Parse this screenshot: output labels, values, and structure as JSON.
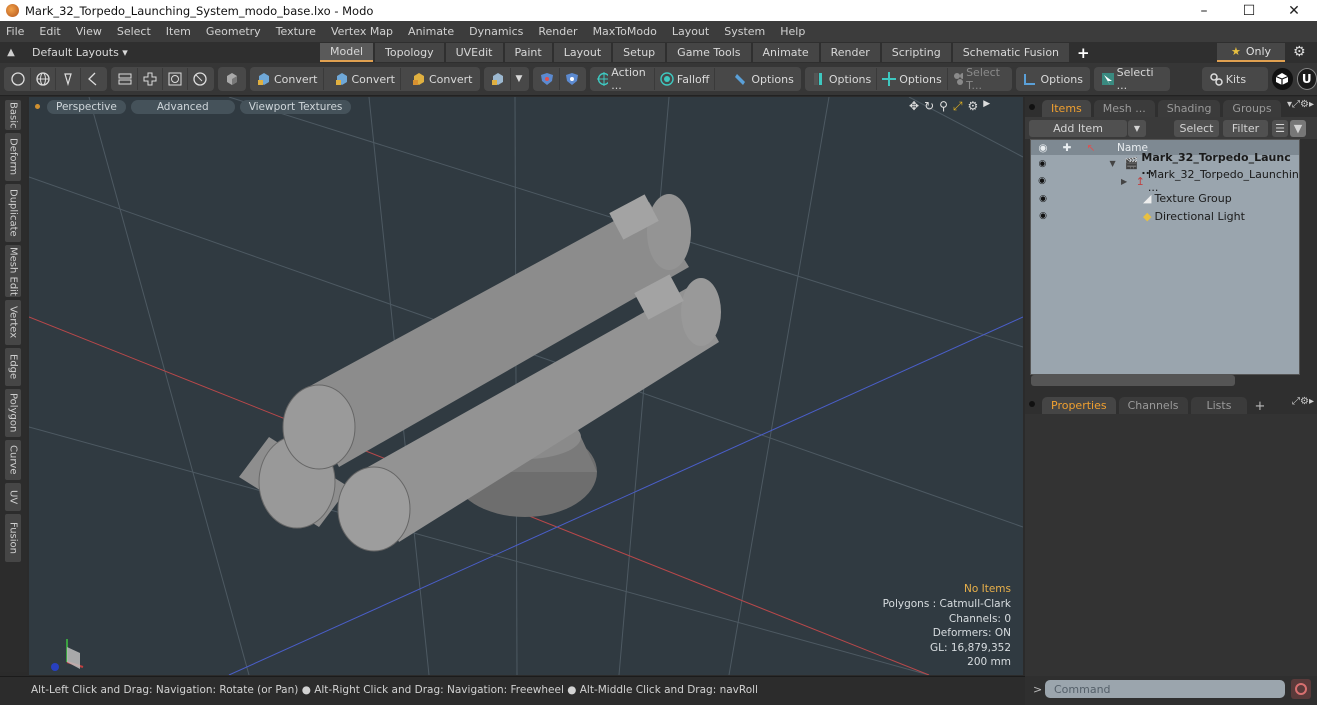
{
  "window": {
    "title": "Mark_32_Torpedo_Launching_System_modo_base.lxo - Modo",
    "controls": [
      "minimize",
      "maximize",
      "close"
    ]
  },
  "menu": [
    "File",
    "Edit",
    "View",
    "Select",
    "Item",
    "Geometry",
    "Texture",
    "Vertex Map",
    "Animate",
    "Dynamics",
    "Render",
    "MaxToModo",
    "Layout",
    "System",
    "Help"
  ],
  "layout_bar": {
    "layouts_dropdown": "Default Layouts ▾",
    "tabs": [
      "Model",
      "Topology",
      "UVEdit",
      "Paint",
      "Layout",
      "Setup",
      "Game Tools",
      "Animate",
      "Render",
      "Scripting",
      "Schematic Fusion"
    ],
    "active_tab": "Model",
    "add_label": "+",
    "only_label": "Only",
    "star": "★"
  },
  "toolbar": {
    "convert1": "Convert",
    "convert2": "Convert",
    "convert3": "Convert",
    "action": "Action ...",
    "falloff": "Falloff",
    "options1": "Options",
    "options2": "Options",
    "options3": "Options",
    "select_t": "Select T...",
    "options4": "Options",
    "selecti": "Selecti ...",
    "kits": "Kits"
  },
  "left_tabs": [
    "Basic",
    "Deform",
    "Duplicate",
    "Mesh Edit",
    "Vertex",
    "Edge",
    "Polygon",
    "Curve",
    "UV",
    "Fusion"
  ],
  "viewport": {
    "view_mode": "Perspective",
    "shading": "Advanced",
    "textures": "Viewport Textures",
    "stats": {
      "selection": "No Items",
      "polygons": "Polygons : Catmull-Clark",
      "channels": "Channels: 0",
      "deformers": "Deformers: ON",
      "gl": "GL: 16,879,352",
      "scale": "200 mm"
    }
  },
  "status_bar": "Alt-Left Click and Drag: Navigation: Rotate (or Pan) ● Alt-Right Click and Drag: Navigation: Freewheel ● Alt-Middle Click and Drag: navRoll",
  "items_panel": {
    "tabs": [
      "Items",
      "Mesh ...",
      "Shading",
      "Groups"
    ],
    "active_tab": "Items",
    "add_item": "Add Item",
    "select": "Select",
    "filter": "Filter",
    "column_name": "Name",
    "rows": [
      {
        "label": "Mark_32_Torpedo_Launc ...",
        "type": "scene",
        "bold": true,
        "expand": "▼"
      },
      {
        "label": "Mark_32_Torpedo_Launchin ...",
        "type": "mesh",
        "bold": false,
        "expand": "▶"
      },
      {
        "label": "Texture Group",
        "type": "texture-group",
        "bold": false,
        "expand": ""
      },
      {
        "label": "Directional Light",
        "type": "light",
        "bold": false,
        "expand": ""
      }
    ]
  },
  "properties_panel": {
    "tabs": [
      "Properties",
      "Channels",
      "Lists"
    ],
    "active_tab": "Properties",
    "add_label": "+"
  },
  "command": {
    "prompt": ">",
    "placeholder": "Command"
  },
  "colors": {
    "accent": "#e0a050",
    "active_tab_text": "#f0a030",
    "viewport_bg": "#303a41",
    "axis_x": "#b8484a",
    "axis_z": "#4a5ec8"
  }
}
